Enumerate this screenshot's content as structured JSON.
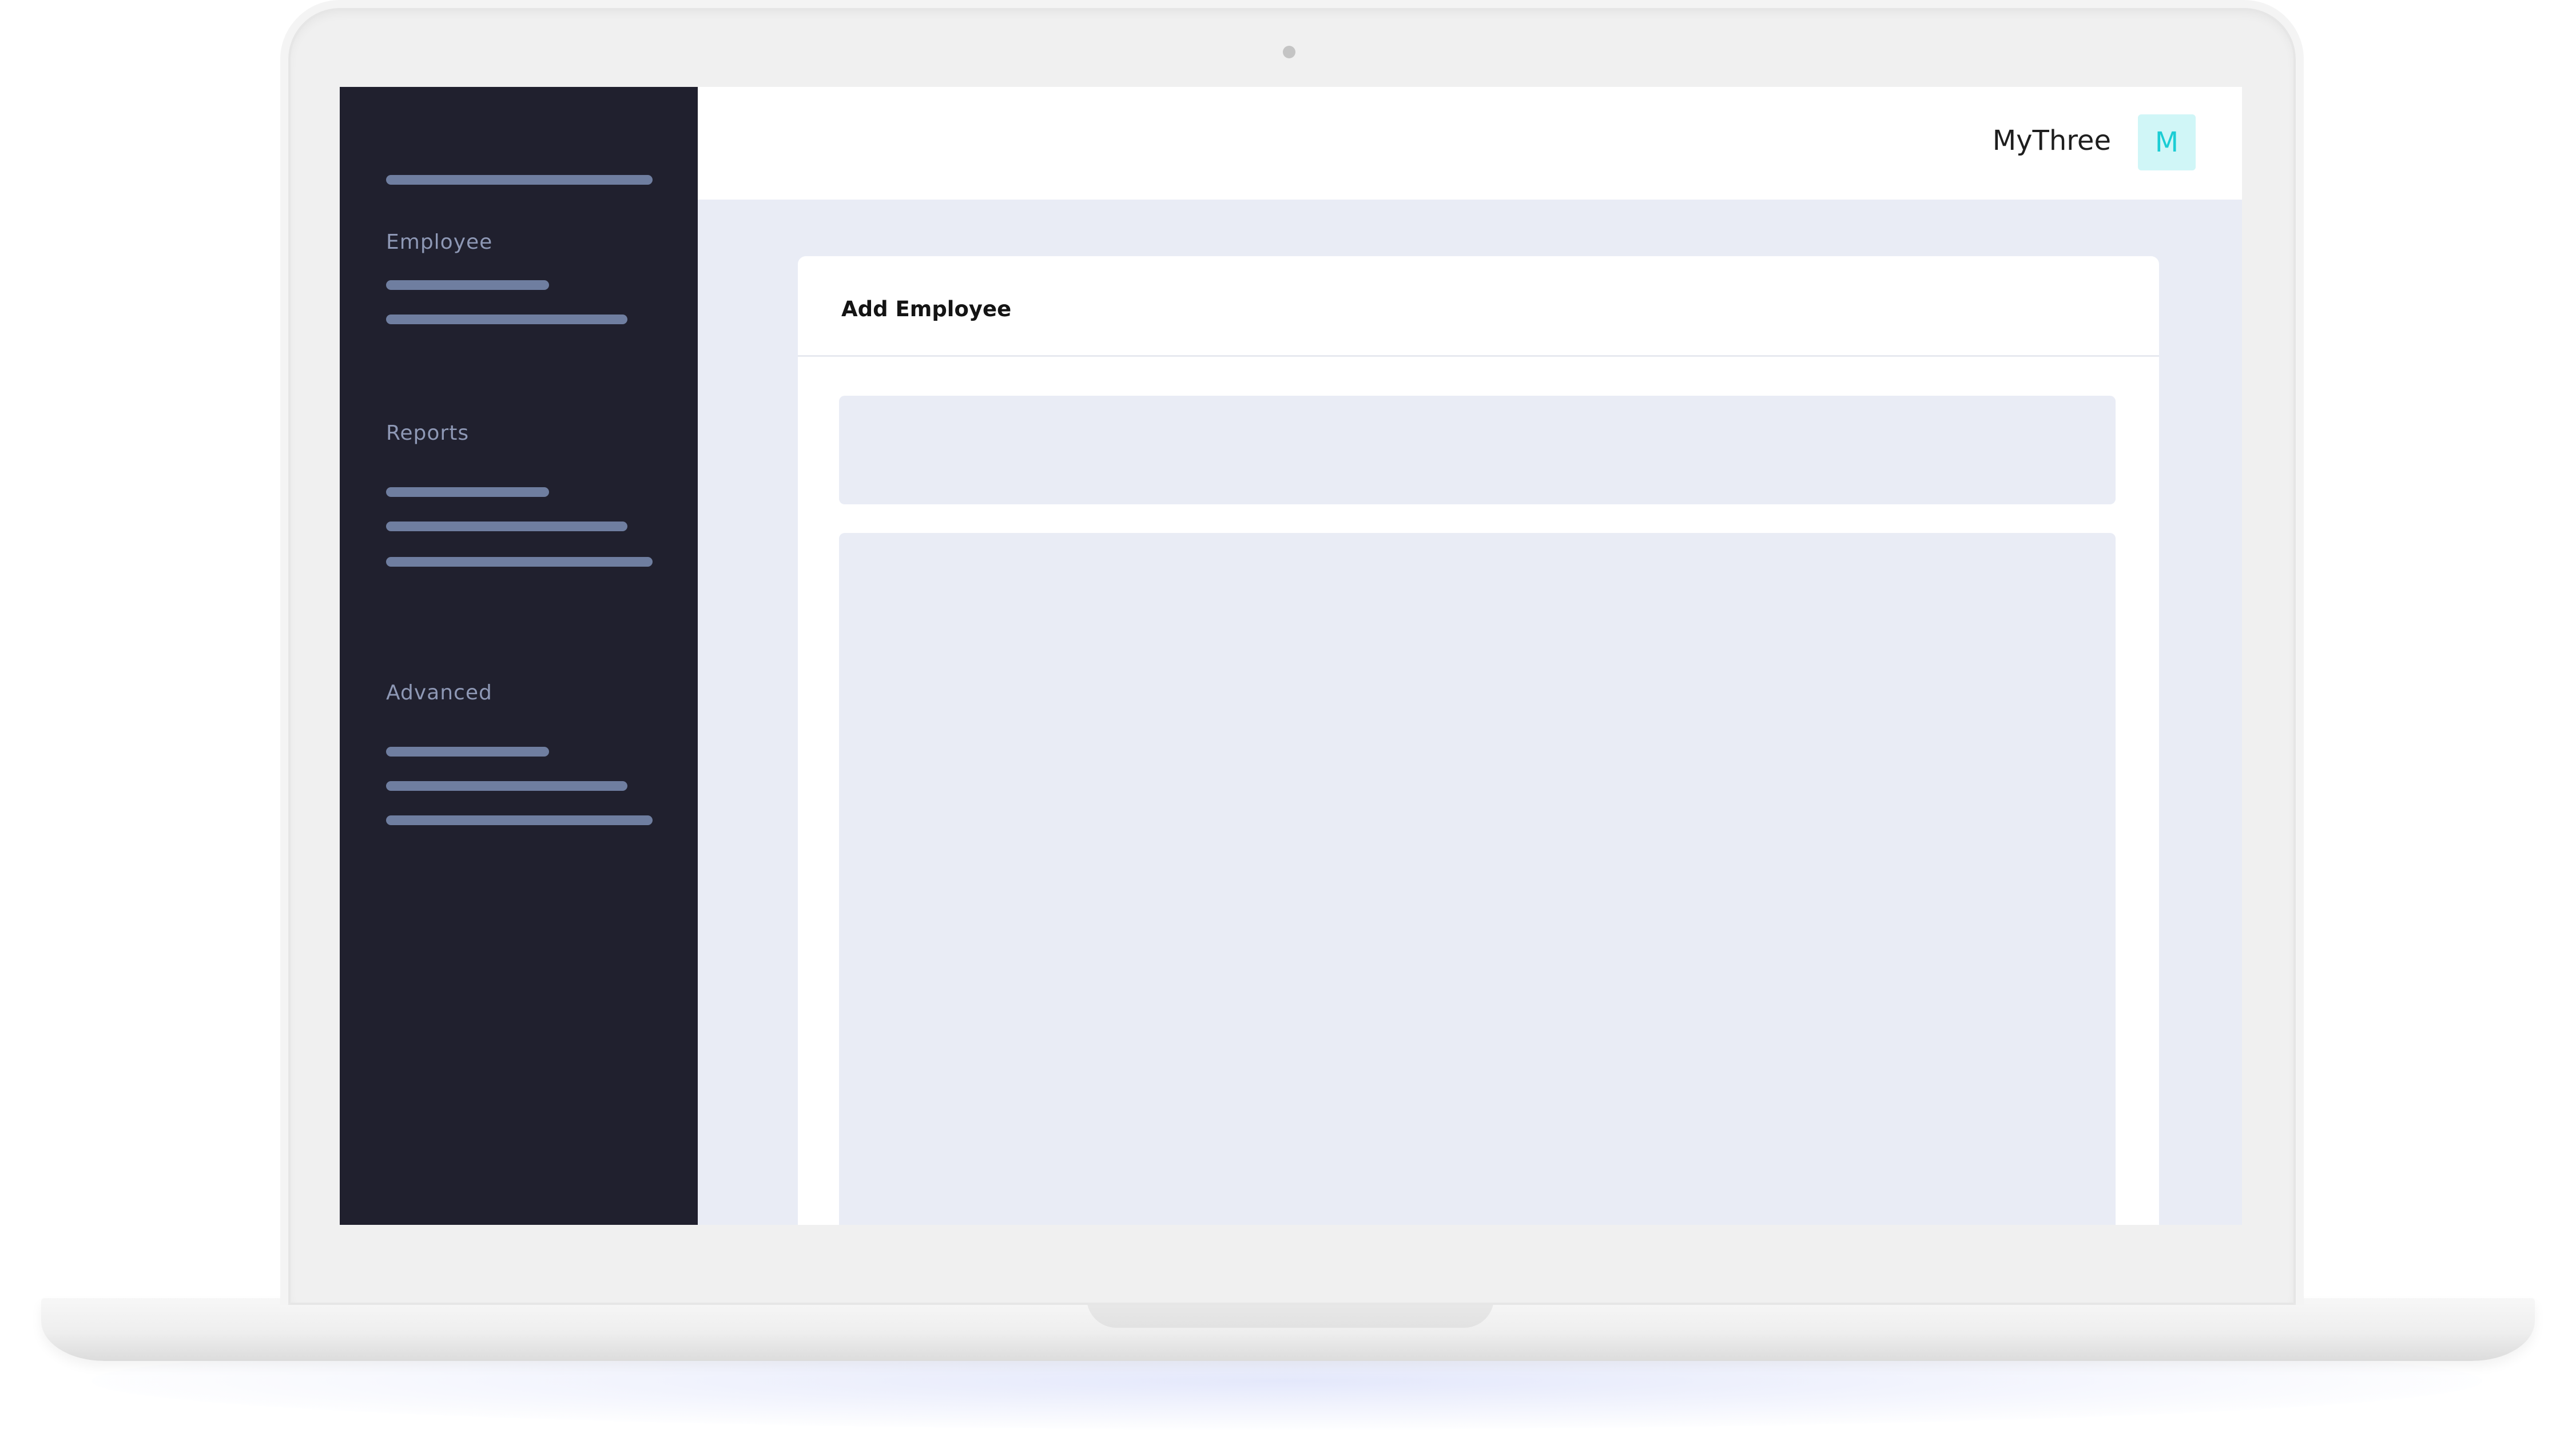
{
  "header": {
    "brand_name": "MyThree",
    "avatar_initial": "M"
  },
  "sidebar": {
    "sections": [
      {
        "title": "Employee"
      },
      {
        "title": "Reports"
      },
      {
        "title": "Advanced"
      }
    ]
  },
  "main": {
    "card_title": "Add Employee"
  },
  "colors": {
    "sidebar_bg": "#20202e",
    "content_bg": "#e9ecf5",
    "avatar_bg": "#d0f6f7",
    "avatar_text": "#1ccdd4"
  }
}
